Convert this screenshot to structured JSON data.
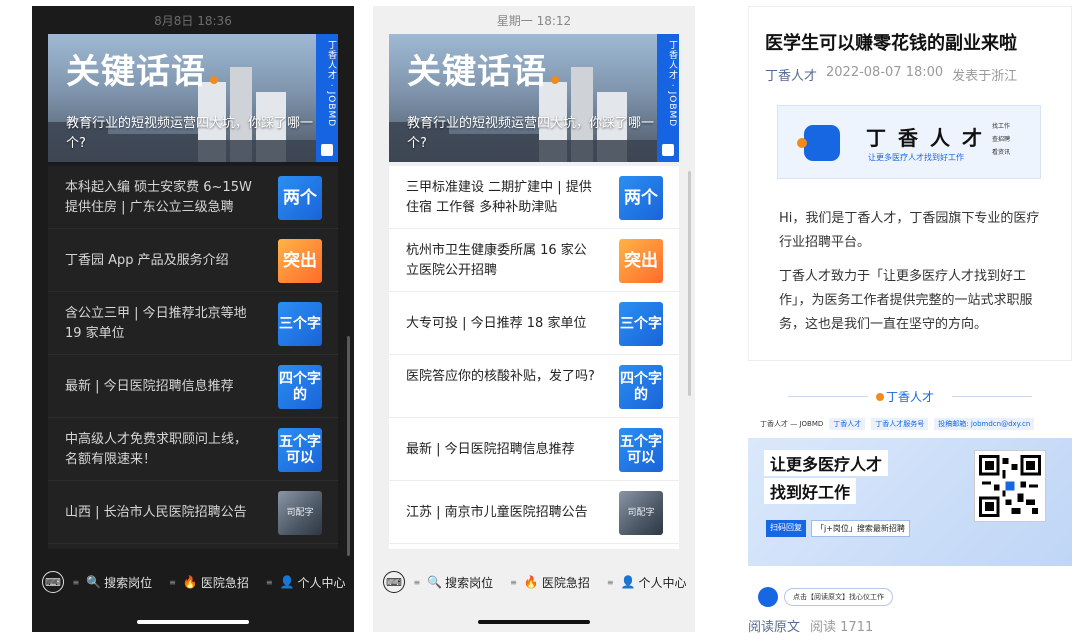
{
  "dark_phone": {
    "status_time": "8月8日 18:36",
    "banner": {
      "title": "关键话语",
      "subtitle": "教育行业的短视频运营四大坑，你踩了哪一个?",
      "side_text": "丁香人才 · JOBMD"
    },
    "items": [
      {
        "text": "本科起入编 硕士安家费 6~15W 提供住房 | 广东公立三级急聘",
        "thumb": "两个"
      },
      {
        "text": "丁香园 App 产品及服务介绍",
        "thumb": "突出"
      },
      {
        "text": "含公立三甲 | 今日推荐北京等地 19 家单位",
        "thumb": "三个字"
      },
      {
        "text": "最新 | 今日医院招聘信息推荐",
        "thumb": "四个字的"
      },
      {
        "text": "中高级人才免费求职顾问上线，名额有限速来！",
        "thumb": "五个字可以"
      },
      {
        "text": "山西 | 长治市人民医院招聘公告",
        "thumb": "司配字"
      }
    ],
    "tabs": {
      "kbd": "⌨",
      "search": "搜索岗位",
      "urgent": "医院急招",
      "me": "个人中心"
    }
  },
  "light_phone": {
    "status_time": "星期一 18:12",
    "banner": {
      "title": "关键话语",
      "subtitle": "教育行业的短视频运营四大坑，你踩了哪一个?",
      "side_text": "丁香人才 · JOBMD"
    },
    "items": [
      {
        "text": "三甲标准建设 二期扩建中 | 提供住宿 工作餐 多种补助津贴",
        "thumb": "两个"
      },
      {
        "text": "杭州市卫生健康委所属 16 家公立医院公开招聘",
        "thumb": "突出"
      },
      {
        "text": "大专可投 | 今日推荐 18 家单位",
        "thumb": "三个字"
      },
      {
        "text": "医院答应你的核酸补贴，发了吗?",
        "thumb": "四个字的"
      },
      {
        "text": "最新 | 今日医院招聘信息推荐",
        "thumb": "五个字可以"
      },
      {
        "text": "江苏 | 南京市儿童医院招聘公告",
        "thumb": "司配字"
      }
    ],
    "tabs": {
      "kbd": "⌨",
      "search": "搜索岗位",
      "urgent": "医院急招",
      "me": "个人中心"
    }
  },
  "article": {
    "title": "医学生可以赚零花钱的副业来啦",
    "account": "丁香人才",
    "date": "2022-08-07 18:00",
    "location": "发表于浙江",
    "logo_name": "丁香人才",
    "logo_slogan": "让更多医疗人才找到好工作",
    "logo_tags": [
      "找工作",
      "查招聘",
      "看资讯"
    ],
    "para1": "Hi，我们是丁香人才，丁香园旗下专业的医疗行业招聘平台。",
    "para2": "丁香人才致力于「让更多医疗人才找到好工作」，为医务工作者提供完整的一站式求职服务，这也是我们一直在坚守的方向。",
    "poster": {
      "brand": "丁香人才",
      "strip": [
        "丁香人才 — JOBMD",
        "丁香人才",
        "丁香人才服务号",
        "投稿邮箱: jobmdcn@dxy.cn"
      ],
      "headline1": "让更多医疗人才",
      "headline2": "找到好工作",
      "tag1": "扫码回复",
      "tag2": "「j+岗位」搜索最新招聘",
      "hint": "点击【阅读原文】找心仪工作"
    },
    "read_original": "阅读原文",
    "read_count": "阅读 1711"
  }
}
